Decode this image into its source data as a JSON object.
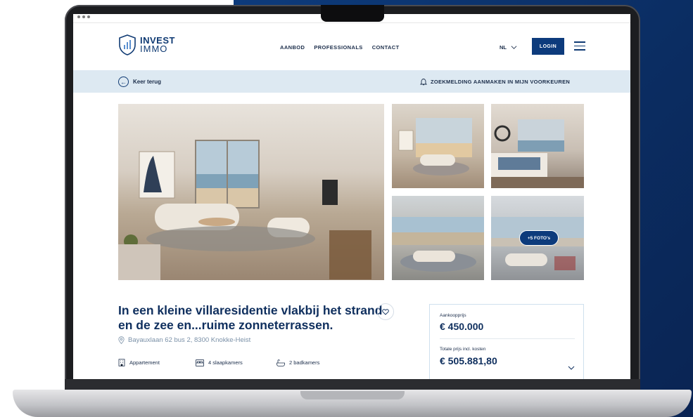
{
  "brand": {
    "line1": "INVEST",
    "line2": "IMMO"
  },
  "nav": {
    "items": [
      "AANBOD",
      "PROFESSIONALS",
      "CONTACT"
    ],
    "lang": "NL",
    "login": "LOGIN"
  },
  "subbar": {
    "back": "Keer terug",
    "alert": "ZOEKMELDING AANMAKEN IN MIJN VOORKEUREN"
  },
  "gallery": {
    "more_label": "+5 FOTO's"
  },
  "listing": {
    "title": "In een kleine villaresidentie vlakbij het strand en de zee en...ruime zonneterrassen.",
    "address": "Bayauxlaan 62 bus 2, 8300 Knokke-Heist",
    "features": [
      "Appartement",
      "4 slaapkamers",
      "2 badkamers"
    ]
  },
  "price": {
    "purchase_label": "Aankoopprijs",
    "purchase_value": "€ 450.000",
    "total_label": "Totale prijs incl. kosten",
    "total_value": "€ 505.881,80"
  },
  "colors": {
    "navy": "#0d3b7c",
    "text": "#0f2f5e",
    "subbar": "#dde9f2"
  }
}
